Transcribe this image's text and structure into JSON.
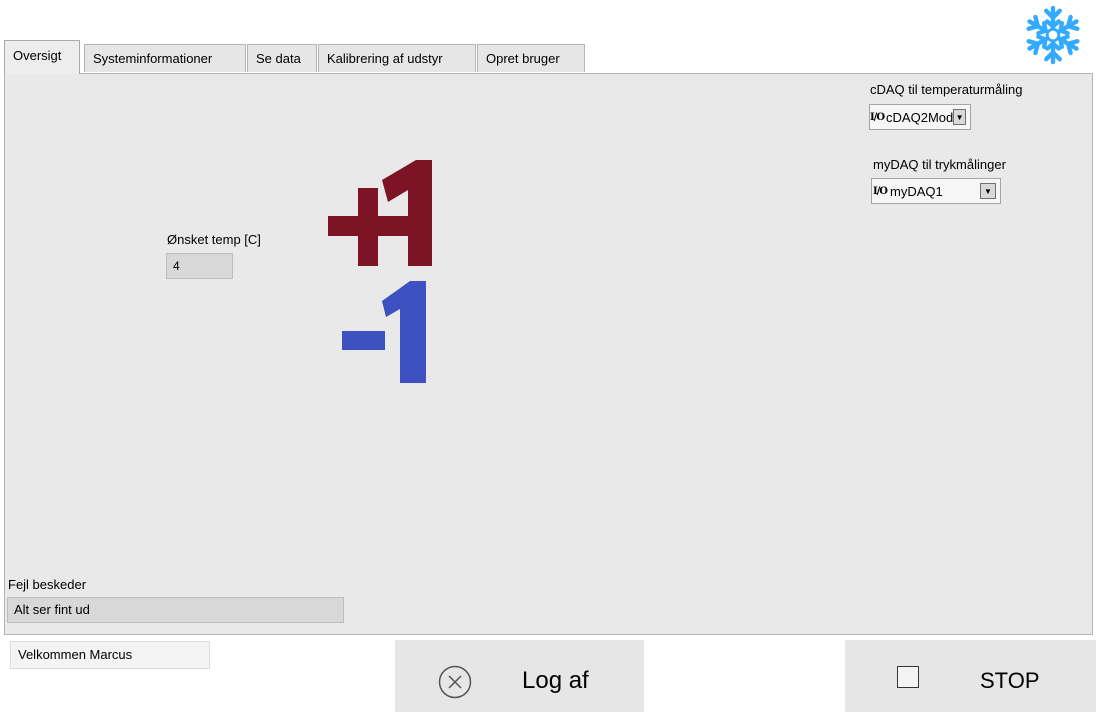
{
  "tabs": [
    {
      "label": "Oversigt",
      "active": true
    },
    {
      "label": "Systeminformationer",
      "active": false
    },
    {
      "label": "Se data",
      "active": false
    },
    {
      "label": "Kalibrering af udstyr",
      "active": false
    },
    {
      "label": "Opret bruger",
      "active": false
    }
  ],
  "temperature": {
    "label": "Ønsket temp [C]",
    "value": "4"
  },
  "adjust": {
    "increase_icon": "plus-one-icon",
    "decrease_icon": "minus-one-icon",
    "increase_color": "#7d1426",
    "decrease_color": "#3d51c0"
  },
  "cdaq": {
    "label": "cDAQ til temperaturmåling",
    "io_symbol": "I/O",
    "value": "cDAQ2Mod"
  },
  "mydaq": {
    "label": "myDAQ til trykmålinger",
    "io_symbol": "I/O",
    "value": "myDAQ1"
  },
  "errors": {
    "label": "Fejl beskeder",
    "value": "Alt ser fint ud"
  },
  "welcome": "Velkommen Marcus",
  "logout_label": "Log af",
  "stop_label": "STOP",
  "logo_icon": "snowflake-icon",
  "snowflake_color": "#33aaff"
}
